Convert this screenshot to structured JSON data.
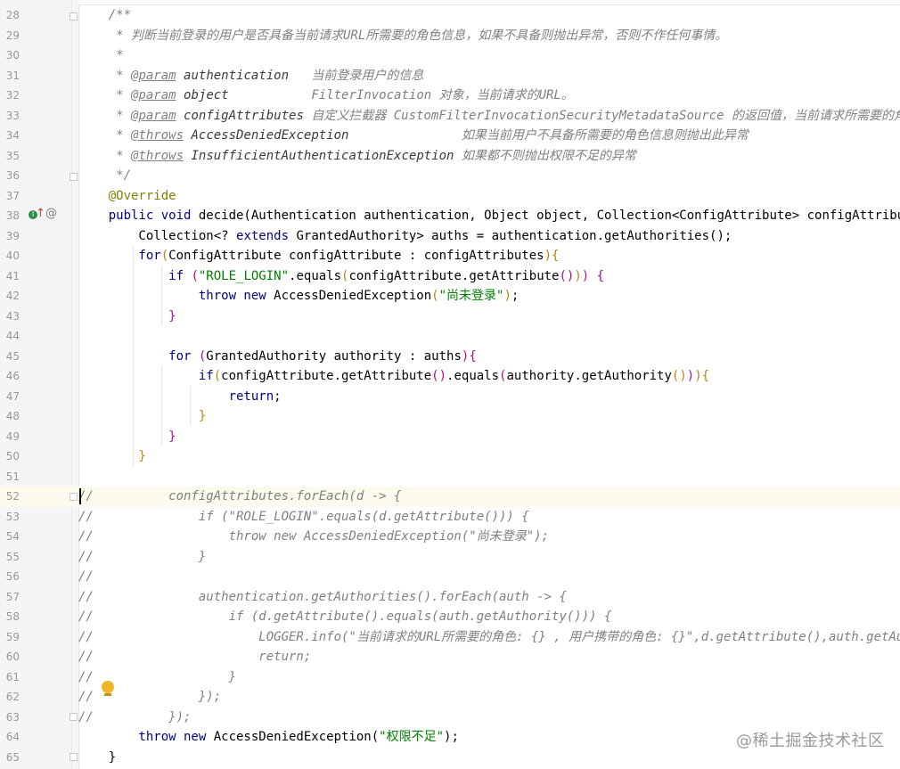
{
  "editor": {
    "current_line": 52,
    "watermark": "@稀土掘金技术社区",
    "gutter_icons": [
      "implements-icon",
      "override-up-arrow-icon",
      "annotation-at-icon",
      "lightbulb-icon"
    ],
    "colors": {
      "keyword": "#000080",
      "string": "#008000",
      "annotation": "#808000",
      "comment": "#808080",
      "line_number": "#999999",
      "current_line_bg": "#fcfaed"
    },
    "lines": [
      {
        "n": "28",
        "t": [
          [
            "doc",
            "    /**"
          ]
        ]
      },
      {
        "n": "29",
        "t": [
          [
            "doc",
            "     * 判断当前登录的用户是否具备当前请求URL所需要的角色信息，如果不具备则抛出异常，否则不作任何事情。"
          ]
        ]
      },
      {
        "n": "30",
        "t": [
          [
            "doc",
            "     *"
          ]
        ]
      },
      {
        "n": "31",
        "t": [
          [
            "doc",
            "     * "
          ],
          [
            "tag",
            "@param"
          ],
          [
            "doc",
            " "
          ],
          [
            "docb",
            "authentication"
          ],
          [
            "doc",
            "   当前登录用户的信息"
          ]
        ]
      },
      {
        "n": "32",
        "t": [
          [
            "doc",
            "     * "
          ],
          [
            "tag",
            "@param"
          ],
          [
            "doc",
            " "
          ],
          [
            "docb",
            "object"
          ],
          [
            "doc",
            "           FilterInvocation 对象，当前请求的URL。"
          ]
        ]
      },
      {
        "n": "33",
        "t": [
          [
            "doc",
            "     * "
          ],
          [
            "tag",
            "@param"
          ],
          [
            "doc",
            " "
          ],
          [
            "docb",
            "configAttributes"
          ],
          [
            "doc",
            " 自定义拦截器 CustomFilterInvocationSecurityMetadataSource 的返回值，当前请求所需要的角色"
          ]
        ]
      },
      {
        "n": "34",
        "t": [
          [
            "doc",
            "     * "
          ],
          [
            "tag",
            "@throws"
          ],
          [
            "doc",
            " "
          ],
          [
            "docb",
            "AccessDeniedException"
          ],
          [
            "doc",
            "               如果当前用户不具备所需要的角色信息则抛出此异常"
          ]
        ]
      },
      {
        "n": "35",
        "t": [
          [
            "doc",
            "     * "
          ],
          [
            "tag",
            "@throws"
          ],
          [
            "doc",
            " "
          ],
          [
            "docb",
            "InsufficientAuthenticationException"
          ],
          [
            "doc",
            " 如果都不则抛出权限不足的异常"
          ]
        ]
      },
      {
        "n": "36",
        "t": [
          [
            "doc",
            "     */"
          ]
        ]
      },
      {
        "n": "37",
        "t": [
          [
            "ann",
            "    @Override"
          ]
        ]
      },
      {
        "n": "38",
        "t": [
          [
            "kw",
            "    public void "
          ],
          [
            "",
            "decide(Authentication authentication, Object object, Collection<ConfigAttribute> configAttributes) t"
          ]
        ]
      },
      {
        "n": "39",
        "t": [
          [
            "",
            "        Collection<? "
          ],
          [
            "kw",
            "extends"
          ],
          [
            "",
            " GrantedAuthority> auths = authentication.getAuthorities();"
          ]
        ]
      },
      {
        "n": "40",
        "t": [
          [
            "kw",
            "        for"
          ],
          [
            "p1",
            "("
          ],
          [
            "",
            "ConfigAttribute configAttribute : configAttributes"
          ],
          [
            "p1",
            ")"
          ],
          [
            "p1",
            "{"
          ]
        ]
      },
      {
        "n": "41",
        "t": [
          [
            "kw",
            "            if "
          ],
          [
            "p2",
            "("
          ],
          [
            "str",
            "\"ROLE_LOGIN\""
          ],
          [
            "",
            ".equals"
          ],
          [
            "p1",
            "("
          ],
          [
            "",
            "configAttribute.getAttribute"
          ],
          [
            "p2",
            "()"
          ],
          [
            "p1",
            ")"
          ],
          [
            "p2",
            ")"
          ],
          [
            "",
            " "
          ],
          [
            "p2",
            "{"
          ]
        ]
      },
      {
        "n": "42",
        "t": [
          [
            "kw",
            "                throw new "
          ],
          [
            "",
            "AccessDeniedException"
          ],
          [
            "p1",
            "("
          ],
          [
            "str",
            "\"尚未登录\""
          ],
          [
            "p1",
            ")"
          ],
          [
            "",
            ";"
          ]
        ]
      },
      {
        "n": "43",
        "t": [
          [
            "p2",
            "            }"
          ]
        ]
      },
      {
        "n": "44",
        "t": [
          [
            "",
            ""
          ]
        ]
      },
      {
        "n": "45",
        "t": [
          [
            "kw",
            "            for "
          ],
          [
            "p2",
            "("
          ],
          [
            "",
            "GrantedAuthority authority : auths"
          ],
          [
            "p2",
            ")"
          ],
          [
            "p2",
            "{"
          ]
        ]
      },
      {
        "n": "46",
        "t": [
          [
            "kw",
            "                if"
          ],
          [
            "p1",
            "("
          ],
          [
            "",
            "configAttribute.getAttribute"
          ],
          [
            "p2",
            "()"
          ],
          [
            "",
            ".equals"
          ],
          [
            "p2",
            "("
          ],
          [
            "",
            "authority.getAuthority"
          ],
          [
            "p1",
            "()"
          ],
          [
            "p2",
            ")"
          ],
          [
            "p1",
            ")"
          ],
          [
            "p1",
            "{"
          ]
        ]
      },
      {
        "n": "47",
        "t": [
          [
            "kw",
            "                    return"
          ],
          [
            "",
            ";"
          ]
        ]
      },
      {
        "n": "48",
        "t": [
          [
            "p1",
            "                }"
          ]
        ]
      },
      {
        "n": "49",
        "t": [
          [
            "p2",
            "            }"
          ]
        ]
      },
      {
        "n": "50",
        "t": [
          [
            "p1",
            "        }"
          ]
        ]
      },
      {
        "n": "51",
        "t": [
          [
            "",
            ""
          ]
        ]
      },
      {
        "n": "52",
        "t": [
          [
            "cm",
            "//          configAttributes.forEach(d -> {"
          ]
        ]
      },
      {
        "n": "53",
        "t": [
          [
            "cm",
            "//              if (\"ROLE_LOGIN\".equals(d.getAttribute())) {"
          ]
        ]
      },
      {
        "n": "54",
        "t": [
          [
            "cm",
            "//                  throw new AccessDeniedException(\"尚未登录\");"
          ]
        ]
      },
      {
        "n": "55",
        "t": [
          [
            "cm",
            "//              }"
          ]
        ]
      },
      {
        "n": "56",
        "t": [
          [
            "cm",
            "//"
          ]
        ]
      },
      {
        "n": "57",
        "t": [
          [
            "cm",
            "//              authentication.getAuthorities().forEach(auth -> {"
          ]
        ]
      },
      {
        "n": "58",
        "t": [
          [
            "cm",
            "//                  if (d.getAttribute().equals(auth.getAuthority())) {"
          ]
        ]
      },
      {
        "n": "59",
        "t": [
          [
            "cm",
            "//                      LOGGER.info(\"当前请求的URL所需要的角色: {} , 用户携带的角色: {}\",d.getAttribute(),auth.getAuthor"
          ]
        ]
      },
      {
        "n": "60",
        "t": [
          [
            "cm",
            "//                      return;"
          ]
        ]
      },
      {
        "n": "61",
        "t": [
          [
            "cm",
            "//                  }"
          ]
        ]
      },
      {
        "n": "62",
        "t": [
          [
            "cm",
            "//              });"
          ]
        ]
      },
      {
        "n": "63",
        "t": [
          [
            "cm",
            "//          });"
          ]
        ]
      },
      {
        "n": "64",
        "t": [
          [
            "kw",
            "        throw new "
          ],
          [
            "",
            "AccessDeniedException("
          ],
          [
            "str",
            "\"权限不足\""
          ],
          [
            "",
            ");"
          ]
        ]
      },
      {
        "n": "65",
        "t": [
          [
            "",
            "    }"
          ]
        ]
      }
    ]
  }
}
